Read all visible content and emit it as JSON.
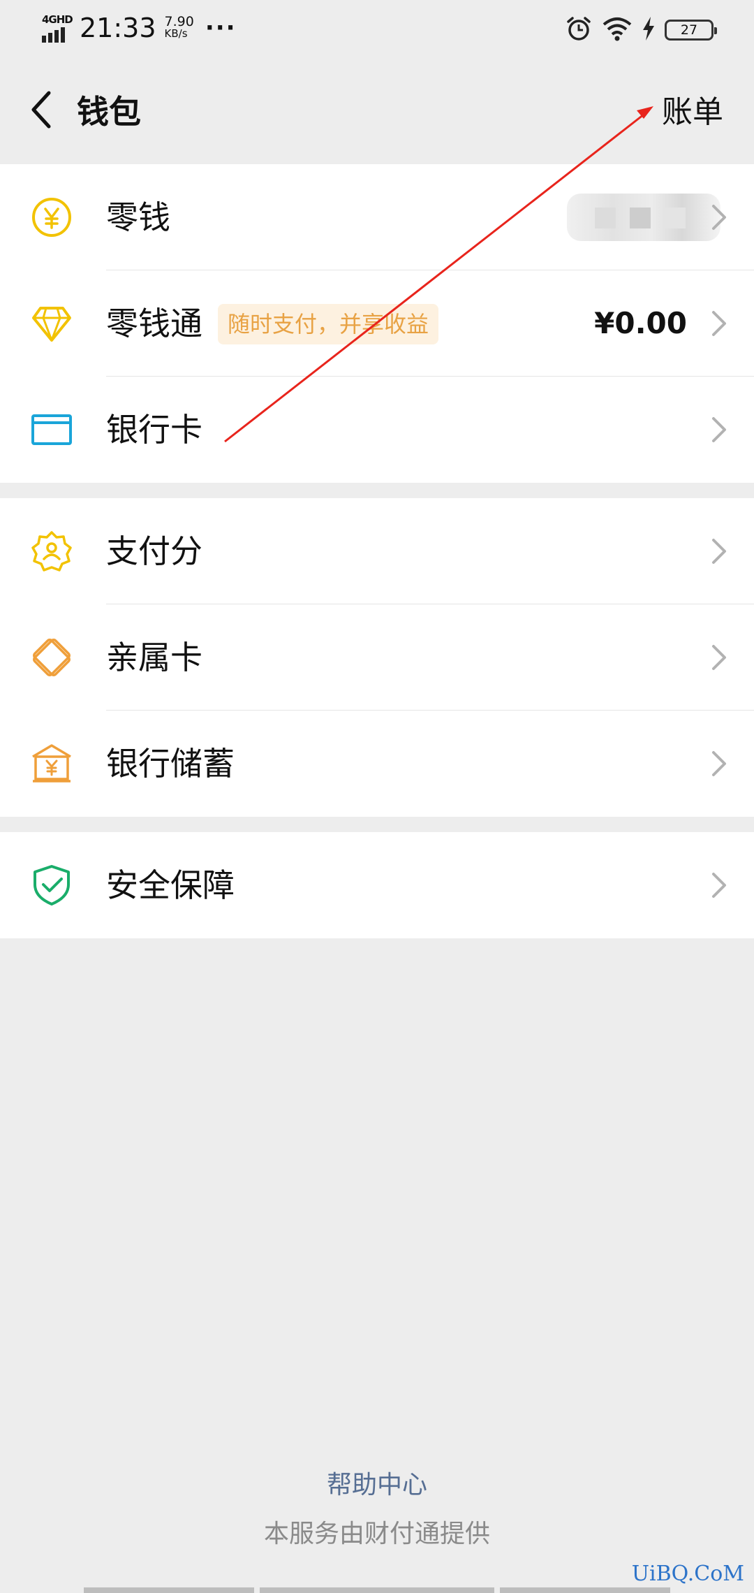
{
  "status_bar": {
    "network": "4GHD",
    "time": "21:33",
    "speed_value": "7.90",
    "speed_unit": "KB/s",
    "more": "···",
    "battery": "27"
  },
  "nav": {
    "title": "钱包",
    "bill_label": "账单"
  },
  "groups": {
    "funds": [
      {
        "label": "零钱",
        "icon": "yuan-coin-icon",
        "value": ""
      },
      {
        "label": "零钱通",
        "icon": "diamond-icon",
        "tag": "随时支付，并享收益",
        "value": "¥0.00"
      },
      {
        "label": "银行卡",
        "icon": "bank-card-icon"
      }
    ],
    "services": [
      {
        "label": "支付分",
        "icon": "payment-score-icon"
      },
      {
        "label": "亲属卡",
        "icon": "family-card-icon"
      },
      {
        "label": "银行储蓄",
        "icon": "bank-savings-icon"
      }
    ],
    "security": [
      {
        "label": "安全保障",
        "icon": "shield-check-icon"
      }
    ]
  },
  "footer": {
    "help_center": "帮助中心",
    "provider": "本服务由财付通提供"
  },
  "watermark": "UiBQ.CoM",
  "colors": {
    "background": "#ededed",
    "yellow_icon": "#f2c200",
    "orange_icon": "#ef9f3a",
    "blue_icon": "#1aa5d9",
    "green_icon": "#1aad6a",
    "tag_text": "#e8a244",
    "annotation": "#e8241c"
  }
}
